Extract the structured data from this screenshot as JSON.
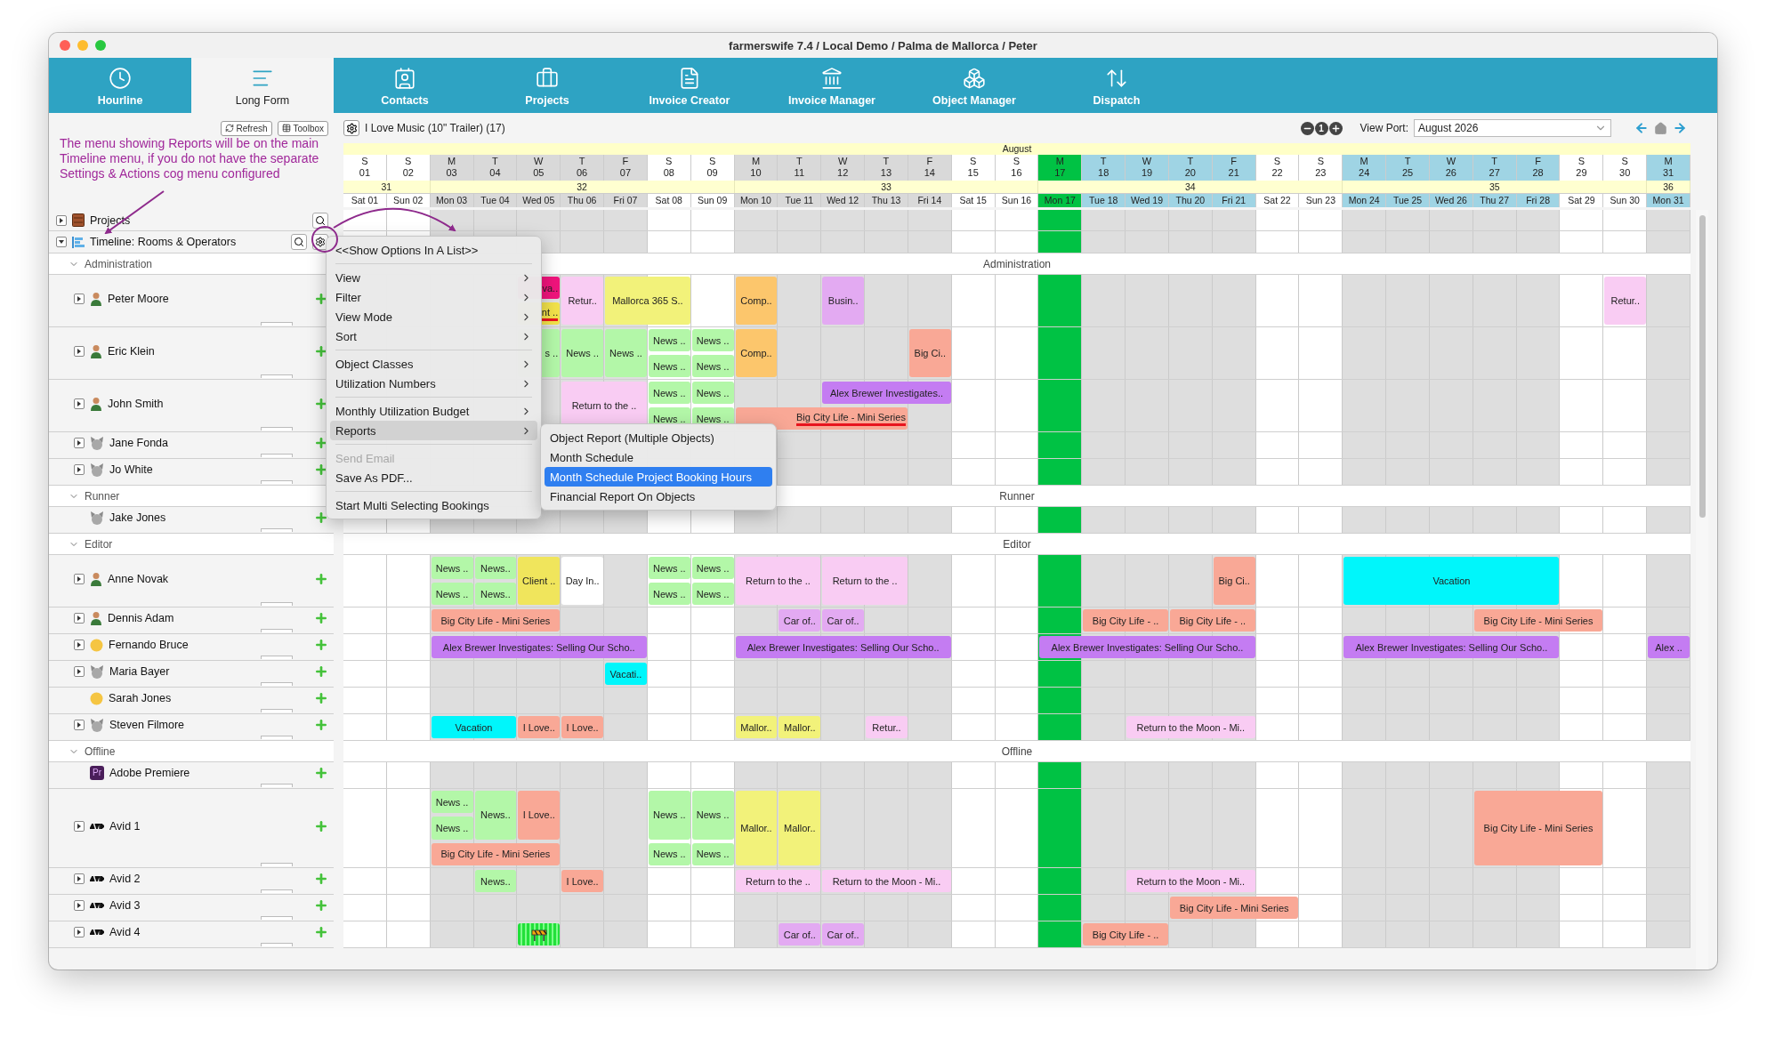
{
  "window": {
    "title": "farmerswife 7.4 / Local Demo / Palma de Mallorca / Peter"
  },
  "tabs": [
    {
      "label": "Hourline",
      "selected": false
    },
    {
      "label": "Long Form",
      "selected": true
    },
    {
      "label": "Contacts",
      "selected": false
    },
    {
      "label": "Projects",
      "selected": false
    },
    {
      "label": "Invoice Creator",
      "selected": false
    },
    {
      "label": "Invoice Manager",
      "selected": false
    },
    {
      "label": "Object Manager",
      "selected": false
    },
    {
      "label": "Dispatch",
      "selected": false
    }
  ],
  "toolbar": {
    "buttons": [
      "Refresh",
      "Toolbox"
    ],
    "project": "I Love Music (10\" Trailer) (17)",
    "zoom_reset": "1",
    "viewport_label": "View Port:",
    "viewport_value": "August 2026"
  },
  "annotation": {
    "text": "The menu showing Reports will be on the main Timeline menu, if you do not have the separate Settings & Actions cog menu configured"
  },
  "timeline": {
    "month": "August",
    "days": [
      {
        "dow": "S",
        "num": "01",
        "label": "Sat 01",
        "kind": "weekend"
      },
      {
        "dow": "S",
        "num": "02",
        "label": "Sun 02",
        "kind": "weekend"
      },
      {
        "dow": "M",
        "num": "03",
        "label": "Mon 03",
        "kind": "past"
      },
      {
        "dow": "T",
        "num": "04",
        "label": "Tue 04",
        "kind": "past"
      },
      {
        "dow": "W",
        "num": "05",
        "label": "Wed 05",
        "kind": "past"
      },
      {
        "dow": "T",
        "num": "06",
        "label": "Thu 06",
        "kind": "past"
      },
      {
        "dow": "F",
        "num": "07",
        "label": "Fri 07",
        "kind": "past"
      },
      {
        "dow": "S",
        "num": "08",
        "label": "Sat 08",
        "kind": "weekend"
      },
      {
        "dow": "S",
        "num": "09",
        "label": "Sun 09",
        "kind": "weekend"
      },
      {
        "dow": "M",
        "num": "10",
        "label": "Mon 10",
        "kind": "past"
      },
      {
        "dow": "T",
        "num": "11",
        "label": "Tue 11",
        "kind": "past"
      },
      {
        "dow": "W",
        "num": "12",
        "label": "Wed 12",
        "kind": "past"
      },
      {
        "dow": "T",
        "num": "13",
        "label": "Thu 13",
        "kind": "past"
      },
      {
        "dow": "F",
        "num": "14",
        "label": "Fri 14",
        "kind": "past"
      },
      {
        "dow": "S",
        "num": "15",
        "label": "Sat 15",
        "kind": "weekend"
      },
      {
        "dow": "S",
        "num": "16",
        "label": "Sun 16",
        "kind": "weekend"
      },
      {
        "dow": "M",
        "num": "17",
        "label": "Mon 17",
        "kind": "today"
      },
      {
        "dow": "T",
        "num": "18",
        "label": "Tue 18",
        "kind": "future"
      },
      {
        "dow": "W",
        "num": "19",
        "label": "Wed 19",
        "kind": "future"
      },
      {
        "dow": "T",
        "num": "20",
        "label": "Thu 20",
        "kind": "future"
      },
      {
        "dow": "F",
        "num": "21",
        "label": "Fri 21",
        "kind": "future"
      },
      {
        "dow": "S",
        "num": "22",
        "label": "Sat 22",
        "kind": "weekend"
      },
      {
        "dow": "S",
        "num": "23",
        "label": "Sun 23",
        "kind": "weekend"
      },
      {
        "dow": "M",
        "num": "24",
        "label": "Mon 24",
        "kind": "future"
      },
      {
        "dow": "T",
        "num": "25",
        "label": "Tue 25",
        "kind": "future"
      },
      {
        "dow": "W",
        "num": "26",
        "label": "Wed 26",
        "kind": "future"
      },
      {
        "dow": "T",
        "num": "27",
        "label": "Thu 27",
        "kind": "future"
      },
      {
        "dow": "F",
        "num": "28",
        "label": "Fri 28",
        "kind": "future"
      },
      {
        "dow": "S",
        "num": "29",
        "label": "Sat 29",
        "kind": "weekend"
      },
      {
        "dow": "S",
        "num": "30",
        "label": "Sun 30",
        "kind": "weekend"
      },
      {
        "dow": "M",
        "num": "31",
        "label": "Mon 31",
        "kind": "future"
      }
    ],
    "weeks": [
      {
        "label": "31"
      },
      {
        "label": "32"
      },
      {
        "label": "33"
      },
      {
        "label": "34"
      },
      {
        "label": "35"
      },
      {
        "label": "36"
      }
    ]
  },
  "tree": {
    "projects": {
      "label": "Projects",
      "expanded": false
    },
    "timeline": {
      "label": "Timeline: Rooms & Operators",
      "expanded": true
    }
  },
  "groups": [
    {
      "label": "Administration",
      "band_label": "Administration",
      "expanded": true,
      "resources": [
        {
          "name": "Peter Moore",
          "avatar": {
            "kind": "person"
          },
          "expandable": true,
          "bookings": [
            {
              "text": "va..",
              "color": "#f0147c",
              "kind": "clipped"
            },
            {
              "text": "nt ..",
              "color": "#f2e24a",
              "kind": "clipped-flagged"
            },
            {
              "text": "Retur..",
              "color": "#f9ccf3",
              "kind": "plain"
            },
            {
              "text": "Mallorca 365 S..",
              "color": "#f2f27a",
              "kind": "plain"
            },
            {
              "text": "Comp..",
              "color": "#fcc66c",
              "kind": "plain"
            },
            {
              "text": "Busin..",
              "color": "#e3aaf2",
              "kind": "plain"
            },
            {
              "text": "Retur..",
              "color": "#f9ccf3",
              "kind": "plain"
            }
          ]
        },
        {
          "name": "Eric Klein",
          "avatar": {
            "kind": "person"
          },
          "expandable": true,
          "bookings": [
            {
              "text": "s ..",
              "color": "#b3f7a8",
              "kind": "clipped"
            },
            {
              "text": "News ..",
              "color": "#b3f7a8",
              "kind": "plain"
            },
            {
              "text": "News ..",
              "color": "#b3f7a8",
              "kind": "plain"
            },
            {
              "text": "News ..",
              "color": "#b3f7a8",
              "kind": "plain"
            },
            {
              "text": "News ..",
              "color": "#b3f7a8",
              "kind": "plain"
            },
            {
              "text": "News ..",
              "color": "#b3f7a8",
              "kind": "plain"
            },
            {
              "text": "News ..",
              "color": "#b3f7a8",
              "kind": "plain"
            },
            {
              "text": "Comp..",
              "color": "#fcc66c",
              "kind": "plain"
            },
            {
              "text": "Big Ci..",
              "color": "#f9a896",
              "kind": "plain"
            }
          ]
        },
        {
          "name": "John Smith",
          "avatar": {
            "kind": "person"
          },
          "expandable": true,
          "bookings": [
            {
              "text": "Return to the ..",
              "color": "#f9ccf3",
              "kind": "plain"
            },
            {
              "text": "News ..",
              "color": "#b3f7a8",
              "kind": "plain"
            },
            {
              "text": "News ..",
              "color": "#b3f7a8",
              "kind": "plain"
            },
            {
              "text": "News ..",
              "color": "#b3f7a8",
              "kind": "plain"
            },
            {
              "text": "News ..",
              "color": "#b3f7a8",
              "kind": "plain"
            },
            {
              "text": "Alex Brewer Investigates..",
              "color": "#c47cf2",
              "kind": "plain"
            },
            {
              "text": "Big City Life - Mini Series",
              "color": "#f9a896",
              "kind": "clipped-flagged"
            }
          ]
        },
        {
          "name": "Jane Fonda",
          "avatar": {
            "kind": "animal"
          },
          "expandable": true
        },
        {
          "name": "Jo White",
          "avatar": {
            "kind": "animal"
          },
          "expandable": true
        }
      ]
    },
    {
      "label": "Runner",
      "band_label": "Runner",
      "expanded": true,
      "resources": [
        {
          "name": "Jake Jones",
          "avatar": {
            "kind": "animal"
          },
          "expandable": false
        }
      ]
    },
    {
      "label": "Editor",
      "band_label": "Editor",
      "expanded": true,
      "resources": [
        {
          "name": "Anne Novak",
          "avatar": {
            "kind": "person"
          },
          "expandable": true,
          "bookings": [
            {
              "text": "News ..",
              "color": "#b3f7a8",
              "kind": "plain"
            },
            {
              "text": "News ..",
              "color": "#b3f7a8",
              "kind": "plain"
            },
            {
              "text": "News..",
              "color": "#b3f7a8",
              "kind": "plain"
            },
            {
              "text": "News..",
              "color": "#b3f7a8",
              "kind": "plain"
            },
            {
              "text": "Client ..",
              "color": "#f0e55c",
              "kind": "plain"
            },
            {
              "text": "Day In..",
              "color": "#ffffff",
              "kind": "plain"
            },
            {
              "text": "News ..",
              "color": "#b3f7a8",
              "kind": "plain"
            },
            {
              "text": "News ..",
              "color": "#b3f7a8",
              "kind": "plain"
            },
            {
              "text": "News ..",
              "color": "#b3f7a8",
              "kind": "plain"
            },
            {
              "text": "News ..",
              "color": "#b3f7a8",
              "kind": "plain"
            },
            {
              "text": "Return to the ..",
              "color": "#f9ccf3",
              "kind": "plain"
            },
            {
              "text": "Return to the ..",
              "color": "#f9ccf3",
              "kind": "plain"
            },
            {
              "text": "Big Ci..",
              "color": "#f9a896",
              "kind": "plain"
            },
            {
              "text": "Vacation",
              "color": "#00f6fb",
              "kind": "plain"
            }
          ]
        },
        {
          "name": "Dennis Adam",
          "avatar": {
            "kind": "person"
          },
          "expandable": true,
          "bookings": [
            {
              "text": "Big City Life - Mini Series",
              "color": "#f9a896",
              "kind": "plain"
            },
            {
              "text": "Car of..",
              "color": "#e3aaf2",
              "kind": "plain"
            },
            {
              "text": "Car of..",
              "color": "#e3aaf2",
              "kind": "plain"
            },
            {
              "text": "Big City Life - ..",
              "color": "#f9a896",
              "kind": "plain"
            },
            {
              "text": "Big City Life - ..",
              "color": "#f9a896",
              "kind": "plain"
            },
            {
              "text": "Big City Life - Mini Series",
              "color": "#f9a896",
              "kind": "plain"
            }
          ]
        },
        {
          "name": "Fernando Bruce",
          "avatar": {
            "kind": "smiley"
          },
          "expandable": true,
          "bookings": [
            {
              "text": "Alex Brewer Investigates: Selling Our Scho..",
              "color": "#c47cf2",
              "kind": "plain"
            },
            {
              "text": "Alex Brewer Investigates: Selling Our Scho..",
              "color": "#c47cf2",
              "kind": "plain"
            },
            {
              "text": "Alex Brewer Investigates: Selling Our Scho..",
              "color": "#c47cf2",
              "kind": "plain"
            },
            {
              "text": "Alex Brewer Investigates: Selling Our Scho..",
              "color": "#c47cf2",
              "kind": "plain"
            },
            {
              "text": "Alex ..",
              "color": "#c47cf2",
              "kind": "plain"
            }
          ]
        },
        {
          "name": "Maria Bayer",
          "avatar": {
            "kind": "animal"
          },
          "expandable": true,
          "bookings": [
            {
              "text": "Vacati..",
              "color": "#00f6fb",
              "kind": "plain"
            }
          ]
        },
        {
          "name": "Sarah Jones",
          "avatar": {
            "kind": "smiley"
          },
          "expandable": false
        },
        {
          "name": "Steven Filmore",
          "avatar": {
            "kind": "animal"
          },
          "expandable": true,
          "bookings": [
            {
              "text": "Vacation",
              "color": "#00f6fb",
              "kind": "plain"
            },
            {
              "text": "I Love..",
              "color": "#f9a896",
              "kind": "plain"
            },
            {
              "text": "I Love..",
              "color": "#f9a896",
              "kind": "plain"
            },
            {
              "text": "Mallor..",
              "color": "#f2f27a",
              "kind": "plain"
            },
            {
              "text": "Mallor..",
              "color": "#f2f27a",
              "kind": "plain"
            },
            {
              "text": "Retur..",
              "color": "#f9ccf3",
              "kind": "plain"
            },
            {
              "text": "Return to the Moon - Mi..",
              "color": "#f9ccf3",
              "kind": "plain"
            }
          ]
        }
      ]
    },
    {
      "label": "Offline",
      "band_label": "Offline",
      "expanded": true,
      "resources": [
        {
          "name": "Adobe Premiere",
          "avatar": {
            "kind": "app",
            "badge": "Pr"
          },
          "expandable": false
        },
        {
          "name": "Avid 1",
          "avatar": {
            "kind": "device"
          },
          "expandable": true,
          "bookings": [
            {
              "text": "News ..",
              "color": "#b3f7a8",
              "kind": "plain"
            },
            {
              "text": "News ..",
              "color": "#b3f7a8",
              "kind": "plain"
            },
            {
              "text": "News..",
              "color": "#b3f7a8",
              "kind": "plain"
            },
            {
              "text": "I Love..",
              "color": "#f9a896",
              "kind": "plain"
            },
            {
              "text": "Big City Life - Mini Series",
              "color": "#f9a896",
              "kind": "plain"
            },
            {
              "text": "News ..",
              "color": "#b3f7a8",
              "kind": "plain"
            },
            {
              "text": "News ..",
              "color": "#b3f7a8",
              "kind": "plain"
            },
            {
              "text": "News ..",
              "color": "#b3f7a8",
              "kind": "plain"
            },
            {
              "text": "News ..",
              "color": "#b3f7a8",
              "kind": "plain"
            },
            {
              "text": "Mallor..",
              "color": "#f2f27a",
              "kind": "plain"
            },
            {
              "text": "Mallor..",
              "color": "#f2f27a",
              "kind": "plain"
            },
            {
              "text": "Big City Life - Mini Series",
              "color": "#f9a896",
              "kind": "plain"
            }
          ]
        },
        {
          "name": "Avid 2",
          "avatar": {
            "kind": "device"
          },
          "expandable": true,
          "bookings": [
            {
              "text": "News..",
              "color": "#b3f7a8",
              "kind": "plain"
            },
            {
              "text": "I Love..",
              "color": "#f9a896",
              "kind": "plain"
            },
            {
              "text": "Return to the ..",
              "color": "#f9ccf3",
              "kind": "plain"
            },
            {
              "text": "Return to the Moon - Mi..",
              "color": "#f9ccf3",
              "kind": "plain"
            },
            {
              "text": "Return to the Moon - Mi..",
              "color": "#f9ccf3",
              "kind": "plain"
            }
          ]
        },
        {
          "name": "Avid 3",
          "avatar": {
            "kind": "device"
          },
          "expandable": true,
          "bookings": [
            {
              "text": "Big City Life - Mini Series",
              "color": "#f9a896",
              "kind": "plain"
            }
          ]
        },
        {
          "name": "Avid 4",
          "avatar": {
            "kind": "device"
          },
          "expandable": true,
          "bookings": [
            {
              "color": "#22e03a",
              "kind": "icon"
            },
            {
              "text": "Car of..",
              "color": "#e3aaf2",
              "kind": "plain"
            },
            {
              "text": "Car of..",
              "color": "#e3aaf2",
              "kind": "plain"
            },
            {
              "text": "Big City Life - ..",
              "color": "#f9a896",
              "kind": "plain"
            }
          ]
        }
      ]
    }
  ],
  "menu": {
    "items": [
      {
        "kind": "item",
        "label": "<<Show Options In A List>>",
        "submenu": false,
        "disabled": false,
        "selected": false
      },
      {
        "kind": "separator"
      },
      {
        "kind": "item",
        "label": "View",
        "submenu": true,
        "disabled": false,
        "selected": false
      },
      {
        "kind": "item",
        "label": "Filter",
        "submenu": true,
        "disabled": false,
        "selected": false
      },
      {
        "kind": "item",
        "label": "View Mode",
        "submenu": true,
        "disabled": false,
        "selected": false
      },
      {
        "kind": "item",
        "label": "Sort",
        "submenu": true,
        "disabled": false,
        "selected": false
      },
      {
        "kind": "separator"
      },
      {
        "kind": "item",
        "label": "Object Classes",
        "submenu": true,
        "disabled": false,
        "selected": false
      },
      {
        "kind": "item",
        "label": "Utilization Numbers",
        "submenu": true,
        "disabled": false,
        "selected": false
      },
      {
        "kind": "separator"
      },
      {
        "kind": "item",
        "label": "Monthly Utilization Budget",
        "submenu": true,
        "disabled": false,
        "selected": false
      },
      {
        "kind": "item",
        "label": "Reports",
        "submenu": true,
        "disabled": false,
        "selected": true
      },
      {
        "kind": "separator"
      },
      {
        "kind": "item",
        "label": "Send Email",
        "submenu": false,
        "disabled": true,
        "selected": false
      },
      {
        "kind": "item",
        "label": "Save As PDF...",
        "submenu": false,
        "disabled": false,
        "selected": false
      },
      {
        "kind": "separator"
      },
      {
        "kind": "item",
        "label": "Start Multi Selecting Bookings",
        "submenu": false,
        "disabled": false,
        "selected": false
      }
    ]
  },
  "submenu": {
    "items": [
      {
        "label": "Object Report (Multiple Objects)",
        "selected": false
      },
      {
        "label": "Month Schedule",
        "selected": false
      },
      {
        "label": "Month Schedule Project Booking Hours",
        "selected": true
      },
      {
        "label": "Financial Report On Objects",
        "selected": false
      }
    ]
  }
}
